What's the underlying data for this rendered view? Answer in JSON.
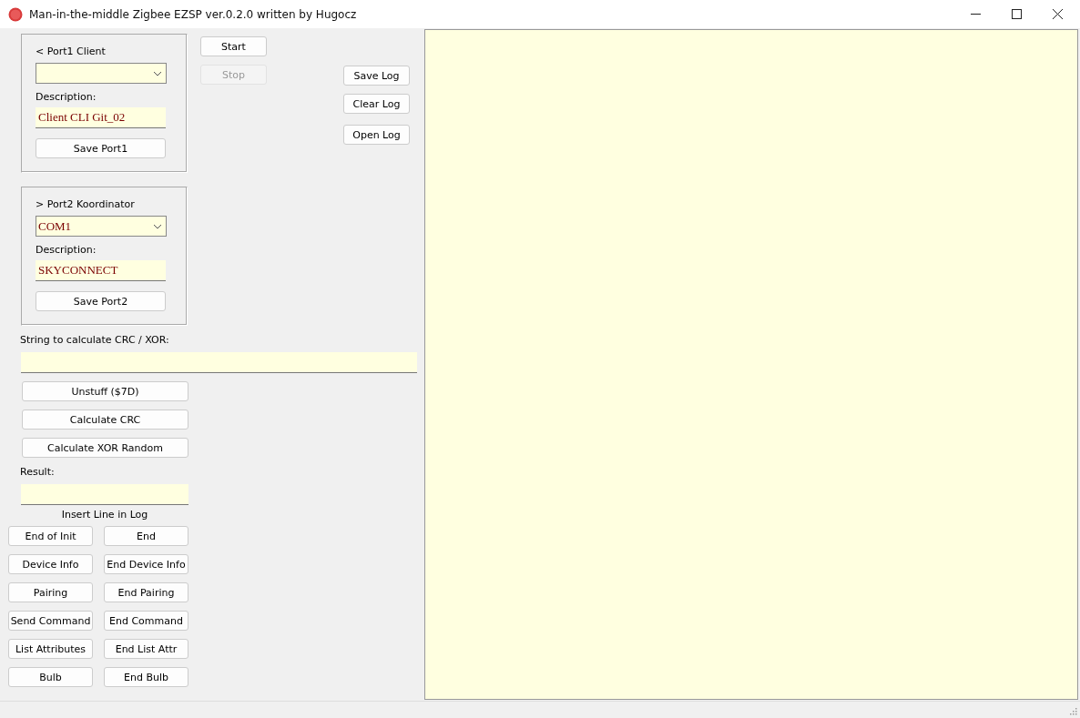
{
  "window": {
    "title": "Man-in-the-middle Zigbee EZSP ver.0.2.0 written by Hugocz"
  },
  "ports": [
    {
      "heading": "< Port1 Client",
      "description_label": "Description:",
      "description": "Client CLI Git_02",
      "save_button": "Save Port1"
    },
    {
      "heading": "> Port2 Koordinator",
      "port": "COM1",
      "description_label": "Description:",
      "description": "SKYCONNECT",
      "save_button": "Save Port2"
    }
  ],
  "run_buttons": [
    {
      "label": "Start",
      "disabled": false
    },
    {
      "label": "Stop",
      "disabled": true
    }
  ],
  "log_buttons": [
    "Save Log",
    "Clear Log",
    "Open Log"
  ],
  "crc": {
    "label": "String to calculate CRC / XOR:",
    "buttons": [
      "Unstuff ($7D)",
      "Calculate CRC",
      "Calculate XOR Random"
    ],
    "result_label": "Result:"
  },
  "insert_line": {
    "title": "Insert Line in Log",
    "buttons": [
      "End of Init",
      "End",
      "Device Info",
      "End Device Info",
      "Pairing",
      "End Pairing",
      "Send Command",
      "End Command",
      "List Attributes",
      "End List Attr",
      "Bulb",
      "End Bulb"
    ]
  }
}
